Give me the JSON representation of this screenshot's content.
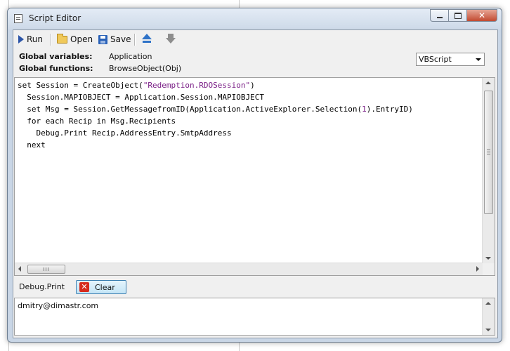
{
  "window": {
    "title": "Script Editor"
  },
  "toolbar": {
    "run_label": "Run",
    "open_label": "Open",
    "save_label": "Save"
  },
  "globals": {
    "variables_label": "Global variables:",
    "variables_value": "Application",
    "functions_label": "Global functions:",
    "functions_value": "BrowseObject(Obj)"
  },
  "language": {
    "selected": "VBScript"
  },
  "editor": {
    "lines": [
      [
        "set Session = CreateObject(",
        "\"Redemption.RDOSession\"",
        ")"
      ],
      [
        "  Session.MAPIOBJECT = Application.Session.MAPIOBJECT",
        "",
        ""
      ],
      [
        "  set Msg = Session.GetMessagefromID(Application.ActiveExplorer.Selection(",
        "1",
        ").EntryID)"
      ],
      [
        "  for each Recip in Msg.Recipients",
        "",
        ""
      ],
      [
        "    Debug.Print Recip.AddressEntry.SmtpAddress",
        "",
        ""
      ],
      [
        "  next",
        "",
        ""
      ]
    ]
  },
  "debug": {
    "label": "Debug.Print",
    "clear_label": "Clear",
    "output": "dmitry@dimastr.com"
  },
  "icons": {
    "run": "play-icon",
    "open": "folder-open-icon",
    "save": "floppy-disk-icon",
    "up": "move-up-icon",
    "down": "move-down-icon",
    "clear": "red-x-icon"
  },
  "colors": {
    "string_literal": "#7a1e86",
    "close_button": "#c24a31",
    "up_arrow": "#2f73c8"
  }
}
